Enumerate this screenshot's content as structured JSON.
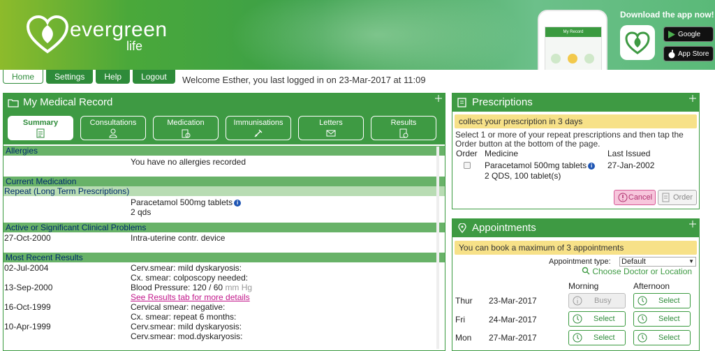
{
  "header": {
    "brand_name": "evergreen",
    "brand_sub": "life",
    "download_text": "Download the app now!",
    "phone_screen_title": "My Record",
    "google_play": "Google play",
    "app_store": "App Store"
  },
  "nav": {
    "tabs": [
      "Home",
      "Settings",
      "Help",
      "Logout"
    ],
    "welcome": "Welcome Esther, you last logged in on 23-Mar-2017 at 11:09"
  },
  "medical_record": {
    "title": "My Medical Record",
    "tabs": [
      "Summary",
      "Consultations",
      "Medication",
      "Immunisations",
      "Letters",
      "Results"
    ],
    "allergies": {
      "heading": "Allergies",
      "text": "You have no allergies recorded"
    },
    "current_medication": {
      "heading": "Current Medication",
      "subheading": "Repeat (Long Term Prescriptions)",
      "drug": "Paracetamol 500mg tablets",
      "dose": "2 qds"
    },
    "problems": {
      "heading": "Active or Significant Clinical Problems",
      "rows": [
        {
          "date": "27-Oct-2000",
          "text": "Intra-uterine contr. device"
        }
      ]
    },
    "results": {
      "heading": "Most Recent Results",
      "rows": [
        {
          "date": "02-Jul-2004",
          "text": "Cerv.smear: mild dyskaryosis:"
        },
        {
          "date": "",
          "text": "Cx. smear: colposcopy needed:"
        },
        {
          "date": "13-Sep-2000",
          "text": "Blood Pressure: 120 / 60",
          "unit": "mm Hg"
        },
        {
          "date": "",
          "text": "See Results tab for more details",
          "link": true
        },
        {
          "date": "16-Oct-1999",
          "text": "Cervical smear: negative:"
        },
        {
          "date": "",
          "text": "Cx. smear: repeat 6 months:"
        },
        {
          "date": "10-Apr-1999",
          "text": "Cerv.smear: mild dyskaryosis:"
        },
        {
          "date": "",
          "text": "Cerv.smear: mod.dyskaryosis:"
        }
      ]
    }
  },
  "prescriptions": {
    "title": "Prescriptions",
    "notice": "collect your prescription in 3 days",
    "instructions": "Select 1 or more of your repeat prescriptions and then tap the Order button at the bottom of the page.",
    "col_order": "Order",
    "col_medicine": "Medicine",
    "col_last": "Last Issued",
    "drug": "Paracetamol 500mg tablets",
    "dose": "2 QDS, 100 tablet(s)",
    "last_issued": "27-Jan-2002",
    "cancel_label": "Cancel",
    "order_label": "Order"
  },
  "appointments": {
    "title": "Appointments",
    "notice": "You can book a maximum of 3 appointments",
    "type_label": "Appointment type:",
    "type_value": "Default",
    "choose_link": "Choose Doctor or Location",
    "col_morning": "Morning",
    "col_afternoon": "Afternoon",
    "rows": [
      {
        "day": "Thur",
        "date": "23-Mar-2017",
        "morning": "Busy",
        "afternoon": "Select"
      },
      {
        "day": "Fri",
        "date": "24-Mar-2017",
        "morning": "Select",
        "afternoon": "Select"
      },
      {
        "day": "Mon",
        "date": "27-Mar-2017",
        "morning": "Select",
        "afternoon": "Select"
      }
    ]
  },
  "colors": {
    "brand_green": "#3e9a43",
    "notice_yellow": "#f7e188",
    "link_pink": "#c2188b",
    "cancel_pink": "#f7c6dc"
  }
}
